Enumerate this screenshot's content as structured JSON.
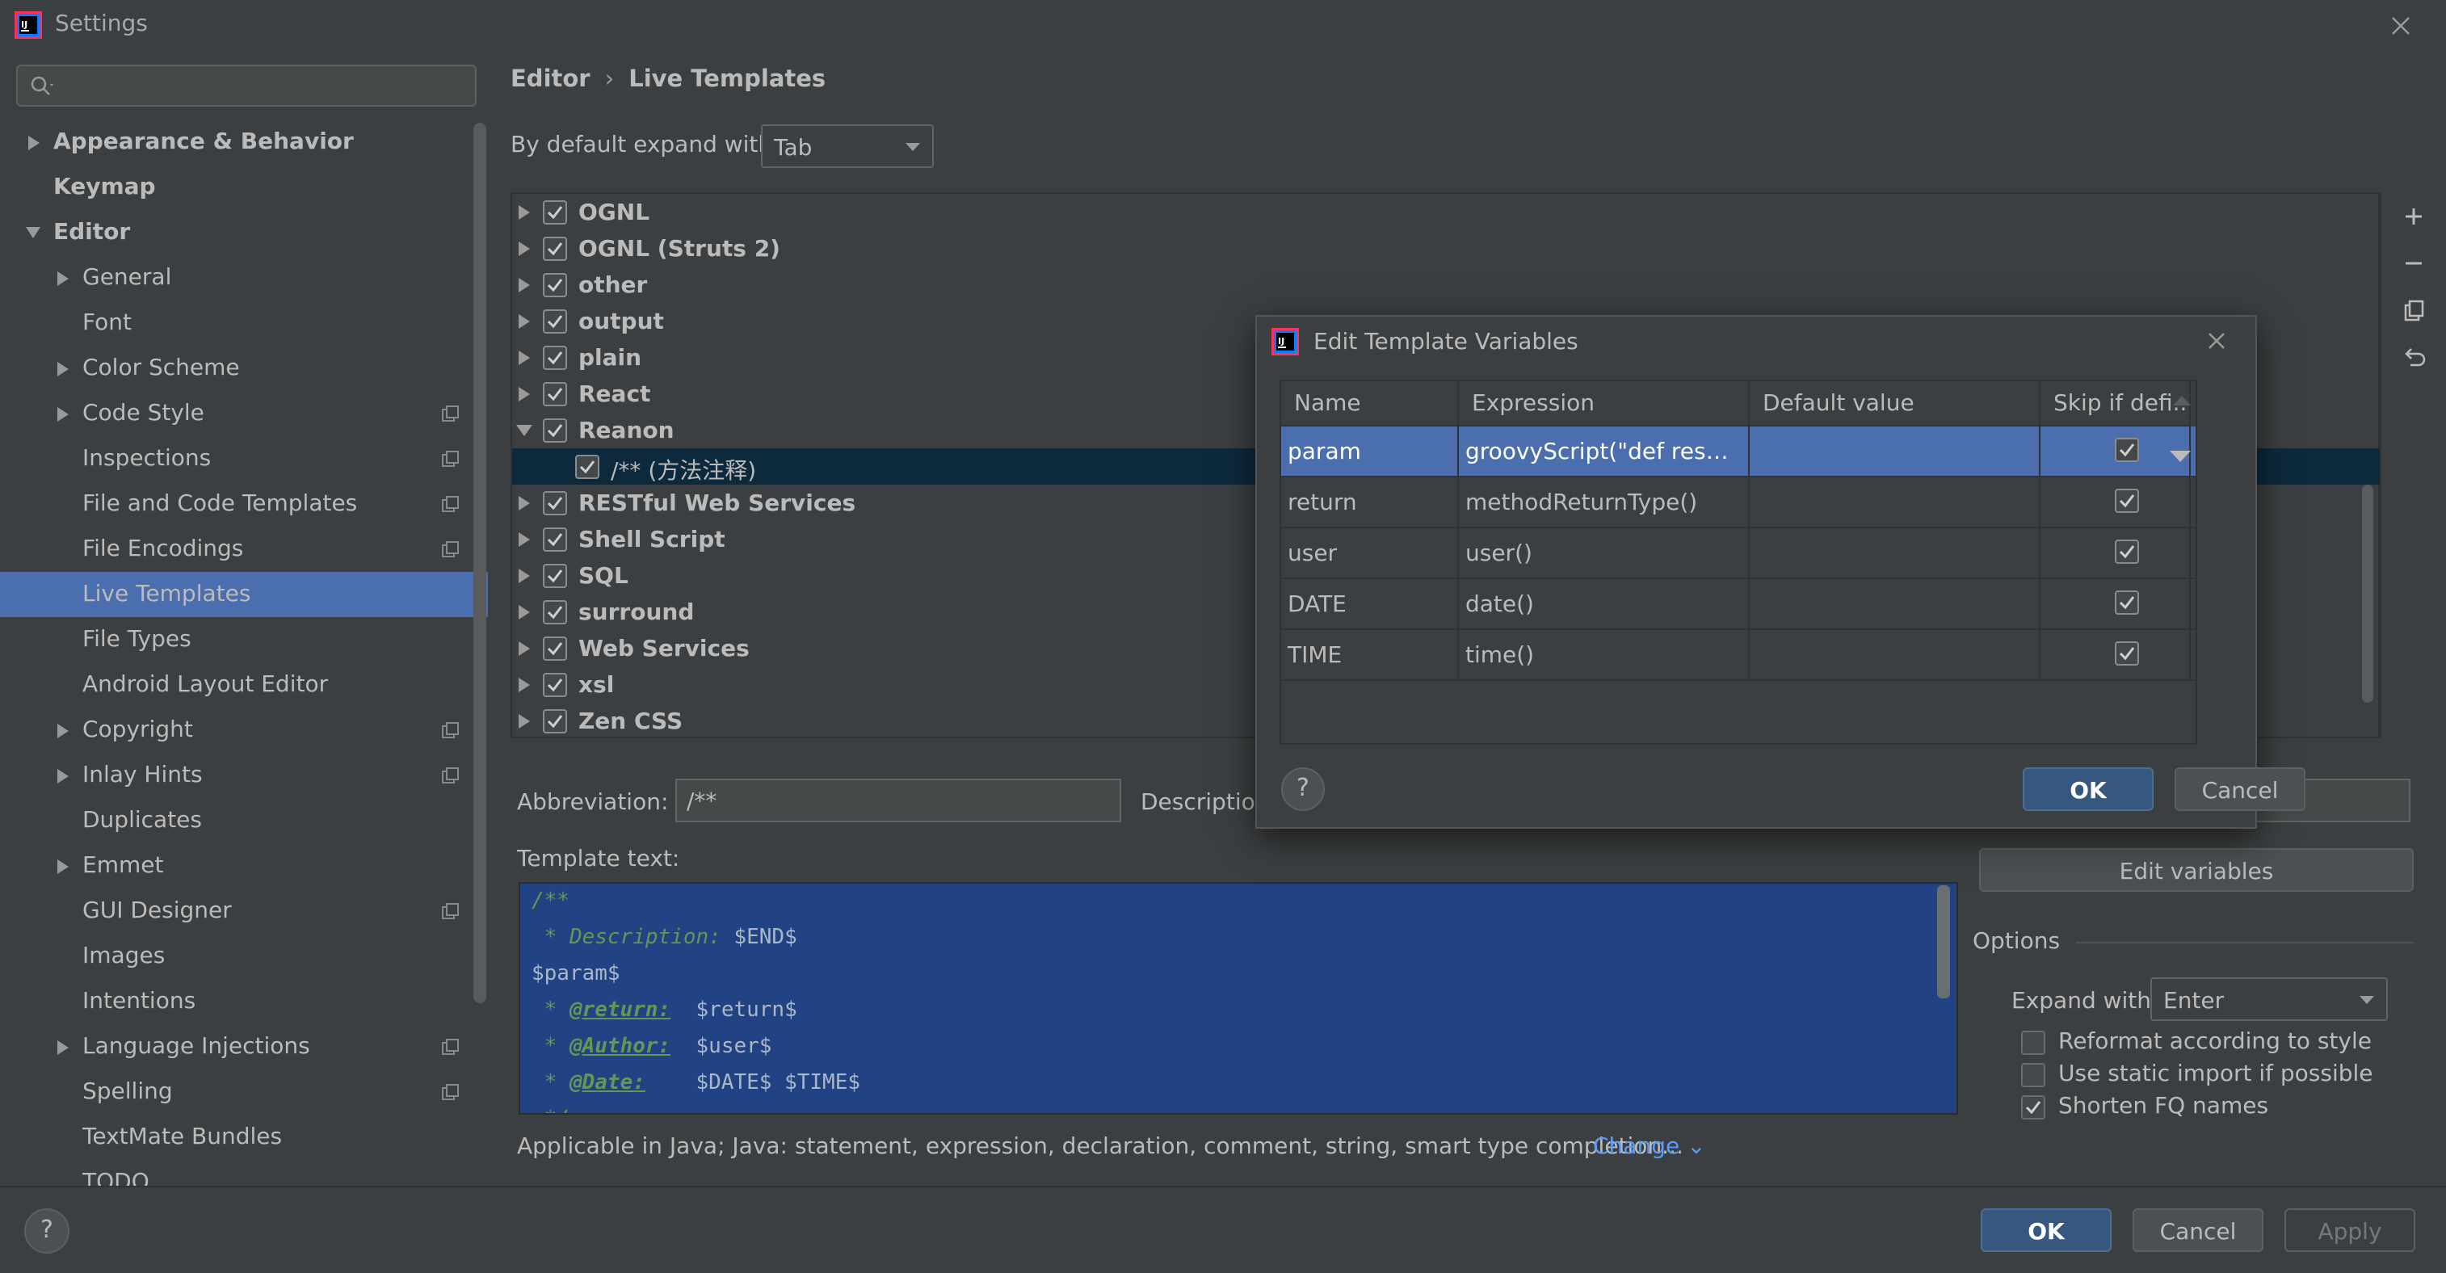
{
  "window": {
    "title": "Settings"
  },
  "sidebar": {
    "search_placeholder": "",
    "items": [
      {
        "label": "Appearance & Behavior"
      },
      {
        "label": "Keymap"
      },
      {
        "label": "Editor"
      },
      {
        "label": "General"
      },
      {
        "label": "Font"
      },
      {
        "label": "Color Scheme"
      },
      {
        "label": "Code Style"
      },
      {
        "label": "Inspections"
      },
      {
        "label": "File and Code Templates"
      },
      {
        "label": "File Encodings"
      },
      {
        "label": "Live Templates"
      },
      {
        "label": "File Types"
      },
      {
        "label": "Android Layout Editor"
      },
      {
        "label": "Copyright"
      },
      {
        "label": "Inlay Hints"
      },
      {
        "label": "Duplicates"
      },
      {
        "label": "Emmet"
      },
      {
        "label": "GUI Designer"
      },
      {
        "label": "Images"
      },
      {
        "label": "Intentions"
      },
      {
        "label": "Language Injections"
      },
      {
        "label": "Spelling"
      },
      {
        "label": "TextMate Bundles"
      },
      {
        "label": "TODO"
      }
    ]
  },
  "breadcrumb": {
    "parent": "Editor",
    "separator": "›",
    "current": "Live Templates"
  },
  "expand": {
    "label": "By default expand with",
    "value": "Tab"
  },
  "tree": {
    "groups": [
      {
        "label": "OGNL"
      },
      {
        "label": "OGNL (Struts 2)"
      },
      {
        "label": "other"
      },
      {
        "label": "output"
      },
      {
        "label": "plain"
      },
      {
        "label": "React"
      },
      {
        "label": "Reanon"
      },
      {
        "label": "/** (方法注释)"
      },
      {
        "label": "RESTful Web Services"
      },
      {
        "label": "Shell Script"
      },
      {
        "label": "SQL"
      },
      {
        "label": "surround"
      },
      {
        "label": "Web Services"
      },
      {
        "label": "xsl"
      },
      {
        "label": "Zen CSS"
      }
    ]
  },
  "template": {
    "abbreviation_label": "Abbreviation:",
    "abbreviation_value": "/**",
    "description_label": "Description:",
    "text_label": "Template text:",
    "lines": {
      "l1": "/**",
      "l2_prefix": " * Description: ",
      "l2_var": "$END$",
      "l3": "$param$",
      "l4_prefix": " * ",
      "l4_tag": "@return:",
      "l4_var": "  $return$",
      "l5_prefix": " * ",
      "l5_tag": "@Author:",
      "l5_var": "  $user$",
      "l6_prefix": " * ",
      "l6_tag": "@Date:",
      "l6_var": "    $DATE$ $TIME$",
      "l7": " */"
    },
    "applicable": "Applicable in Java; Java: statement, expression, declaration, comment, string, smart type completion...",
    "change_link": "Change ⌄"
  },
  "options": {
    "edit_variables": "Edit variables",
    "title": "Options",
    "expand_with_label": "Expand with",
    "expand_with_value": "Enter",
    "reformat": "Reformat according to style",
    "static_import": "Use static import if possible",
    "shorten_fq": "Shorten FQ names"
  },
  "dialog": {
    "title": "Edit Template Variables",
    "columns": [
      "Name",
      "Expression",
      "Default value",
      "Skip if defi..."
    ],
    "rows": [
      {
        "name": "param",
        "expression": "groovyScript(\"def result...",
        "default": "",
        "skip": true
      },
      {
        "name": "return",
        "expression": "methodReturnType()",
        "default": "",
        "skip": true
      },
      {
        "name": "user",
        "expression": "user()",
        "default": "",
        "skip": true
      },
      {
        "name": "DATE",
        "expression": "date()",
        "default": "",
        "skip": true
      },
      {
        "name": "TIME",
        "expression": "time()",
        "default": "",
        "skip": true
      }
    ],
    "ok": "OK",
    "cancel": "Cancel",
    "help": "?"
  },
  "footer": {
    "ok": "OK",
    "cancel": "Cancel",
    "apply": "Apply",
    "help": "?"
  },
  "colors": {
    "accent": "#4b6eaf",
    "primary_button": "#365880",
    "link": "#589df6",
    "editor_selection": "#214283"
  }
}
